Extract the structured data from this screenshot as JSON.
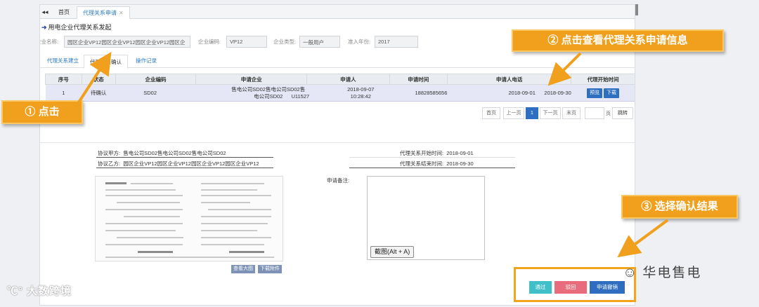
{
  "tabbar": {
    "home": "首页",
    "active_tab": "代理关系申请",
    "close": "✕"
  },
  "page_title": "用电企业代理关系发起",
  "form": {
    "company_name_label": "企业名称:",
    "company_name_value": "园区企业VP12园区企业VP12园区企业VP12园区企",
    "company_code_label": "企业编码:",
    "company_code_value": "VP12",
    "company_type_label": "企业类型:",
    "company_type_value": "一般用户",
    "entry_year_label": "准入年份:",
    "entry_year_value": "2017"
  },
  "subtabs": [
    "代理关系建立",
    "代理关系确认",
    "操作记录"
  ],
  "grid": {
    "headers": [
      "序号",
      "状态",
      "企业编码",
      "申请企业",
      "申请人",
      "申请时间",
      "申请人电话",
      "代理开始时间"
    ],
    "row": {
      "index": "1",
      "status": "待确认",
      "code": "SD02",
      "company": "售电公司SD02售电公司SD02售电公司SD02",
      "applicant": "U11527",
      "date": "2018-09-07",
      "time": "10:28:42",
      "phone": "18828585656",
      "start": "2018-09-01",
      "end": "2018-09-30",
      "preview": "预览",
      "download": "下载"
    }
  },
  "pager": {
    "first": "首页",
    "prev": "上一页",
    "current": "1",
    "next": "下一页",
    "last": "末页",
    "page_unit": "页",
    "jump": "跳转"
  },
  "detail": {
    "party_a_label": "协议甲方:",
    "party_a_value": "售电公司SD02售电公司SD02售电公司SD02",
    "party_b_label": "协议乙方:",
    "party_b_value": "园区企业VP12园区企业VP12园区企业VP12园区企业VP12",
    "start_label": "代理关系开始时间:",
    "start_value": "2018-09-01",
    "end_label": "代理关系结束时间:",
    "end_value": "2018-09-30",
    "view_large": "查看大图",
    "download_attachment": "下载附件",
    "memo_label": "申请备注:",
    "tooltip": "截图(Alt + A)"
  },
  "actions": {
    "approve": "通过",
    "reject": "驳回",
    "revoke": "申请撤销",
    "approve_color": "#3fbfc8",
    "reject_color": "#e86c7b",
    "revoke_color": "#2e6dbf"
  },
  "callouts": {
    "c1": "① 点击",
    "c2": "② 点击查看代理关系申请信息",
    "c3": "③ 选择确认结果",
    "color": "#f0a01c"
  },
  "branding": {
    "right": "华电售电",
    "left": "大数跨境"
  }
}
